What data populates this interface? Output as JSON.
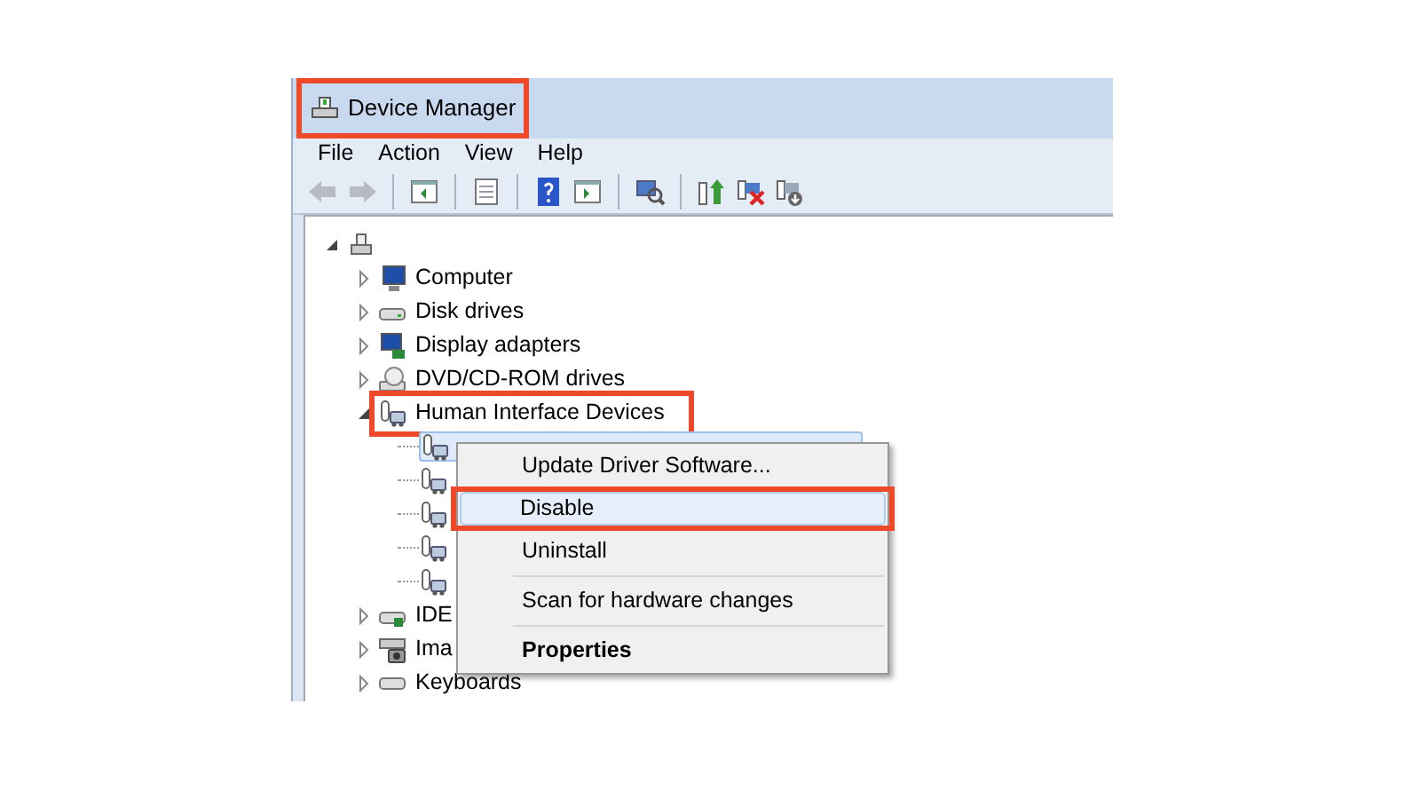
{
  "window": {
    "title": "Device Manager",
    "annotated": true
  },
  "menu": [
    "File",
    "Action",
    "View",
    "Help"
  ],
  "toolbar": [
    {
      "kind": "back",
      "disabled": true
    },
    {
      "kind": "forward",
      "disabled": true
    },
    {
      "kind": "separator"
    },
    {
      "kind": "tree"
    },
    {
      "kind": "separator"
    },
    {
      "kind": "sheet"
    },
    {
      "kind": "separator"
    },
    {
      "kind": "help"
    },
    {
      "kind": "pane"
    },
    {
      "kind": "separator"
    },
    {
      "kind": "scan"
    },
    {
      "kind": "separator"
    },
    {
      "kind": "update"
    },
    {
      "kind": "remove"
    },
    {
      "kind": "install"
    }
  ],
  "tree": {
    "expanded": true,
    "children": [
      {
        "label": "Computer",
        "kind": "computer",
        "expanded": false
      },
      {
        "label": "Disk drives",
        "kind": "disk",
        "expanded": false
      },
      {
        "label": "Display adapters",
        "kind": "display",
        "expanded": false
      },
      {
        "label": "DVD/CD-ROM drives",
        "kind": "dvd",
        "expanded": false
      },
      {
        "label": "Human Interface Devices",
        "kind": "hid",
        "expanded": true,
        "annotated": true,
        "children": [
          {
            "kind": "hid",
            "selected": true
          },
          {
            "kind": "hid",
            "selected": false
          },
          {
            "kind": "hid",
            "selected": false
          },
          {
            "kind": "hid",
            "selected": false
          },
          {
            "kind": "hid",
            "selected": false
          }
        ]
      },
      {
        "label": "IDE",
        "kind": "ide",
        "expanded": false
      },
      {
        "label": "Ima",
        "kind": "camera",
        "expanded": false
      },
      {
        "label": "Keyboards",
        "kind": "keyboard",
        "expanded": false
      }
    ]
  },
  "context_menu": [
    {
      "kind": "item",
      "label": "Update Driver Software...",
      "selected": false
    },
    {
      "kind": "item",
      "label": "Disable",
      "selected": true,
      "annotated": true
    },
    {
      "kind": "item",
      "label": "Uninstall",
      "selected": false
    },
    {
      "kind": "separator"
    },
    {
      "kind": "item",
      "label": "Scan for hardware changes",
      "selected": false
    },
    {
      "kind": "separator"
    },
    {
      "kind": "default",
      "label": "Properties",
      "selected": false
    }
  ]
}
